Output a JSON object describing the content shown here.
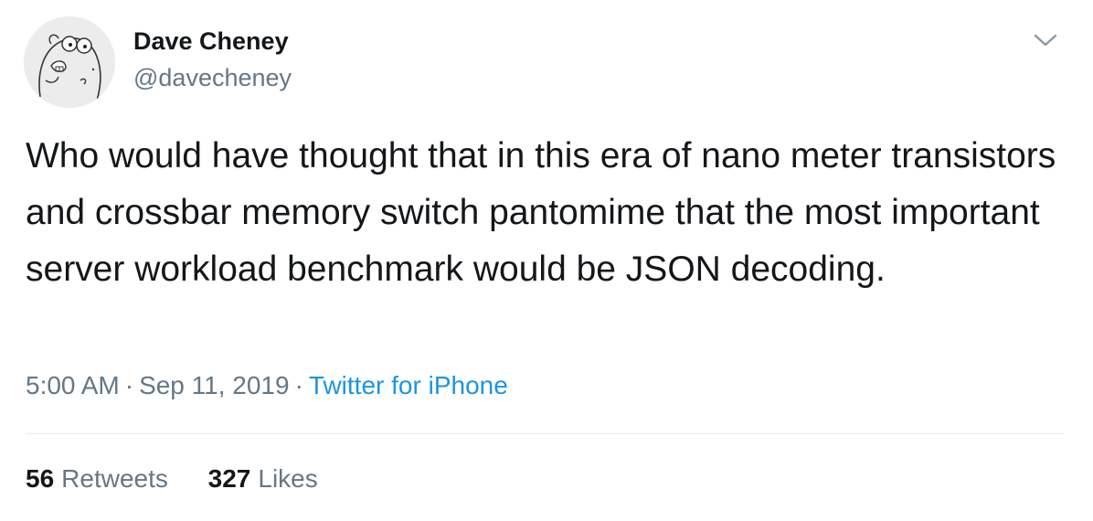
{
  "tweet": {
    "author": {
      "name": "Dave Cheney",
      "handle": "@davecheney",
      "avatar_icon": "gopher-sketch-avatar"
    },
    "text": "Who would have thought that in this era of nano meter transistors and crossbar memory switch pantomime that the most important server workload benchmark would be JSON decoding.",
    "time": "5:00 AM",
    "date": "Sep 11, 2019",
    "separator": "·",
    "source": "Twitter for iPhone",
    "stats": {
      "retweets_count": "56",
      "retweets_label": "Retweets",
      "likes_count": "327",
      "likes_label": "Likes"
    },
    "menu_icon": "chevron-down-icon"
  },
  "colors": {
    "text": "#14171a",
    "secondary": "#657786",
    "link": "#1b95e0",
    "divider": "#e6ecf0"
  }
}
